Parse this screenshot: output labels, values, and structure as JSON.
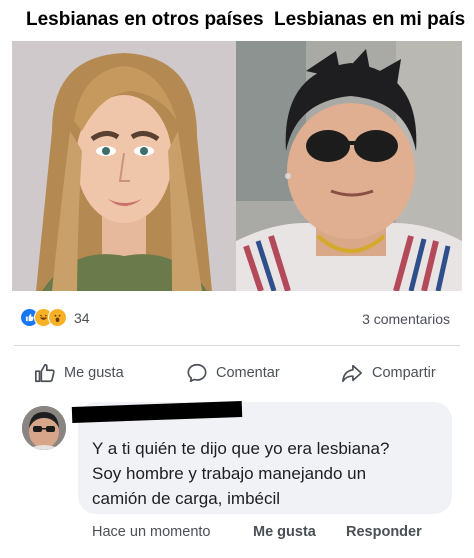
{
  "meme": {
    "left_caption": "Lesbianas en otros países",
    "right_caption": "Lesbianas en mi país"
  },
  "post_stats": {
    "reaction_icons": [
      "like-icon",
      "haha-icon",
      "wow-icon"
    ],
    "reaction_count": "34",
    "comments_label": "3 comentarios"
  },
  "actions": {
    "like_label": "Me gusta",
    "comment_label": "Comentar",
    "share_label": "Compartir"
  },
  "comment": {
    "lines": [
      "Y a ti quién te dijo que yo era lesbiana?",
      "Soy hombre y trabajo manejando un",
      "camión de carga, imbécil"
    ],
    "time_label": "Hace un momento",
    "like_label": "Me gusta",
    "reply_label": "Responder"
  },
  "colors": {
    "accent": "#1877f2",
    "muted_text": "#4b4f56",
    "bubble_bg": "#f0f2f5"
  }
}
